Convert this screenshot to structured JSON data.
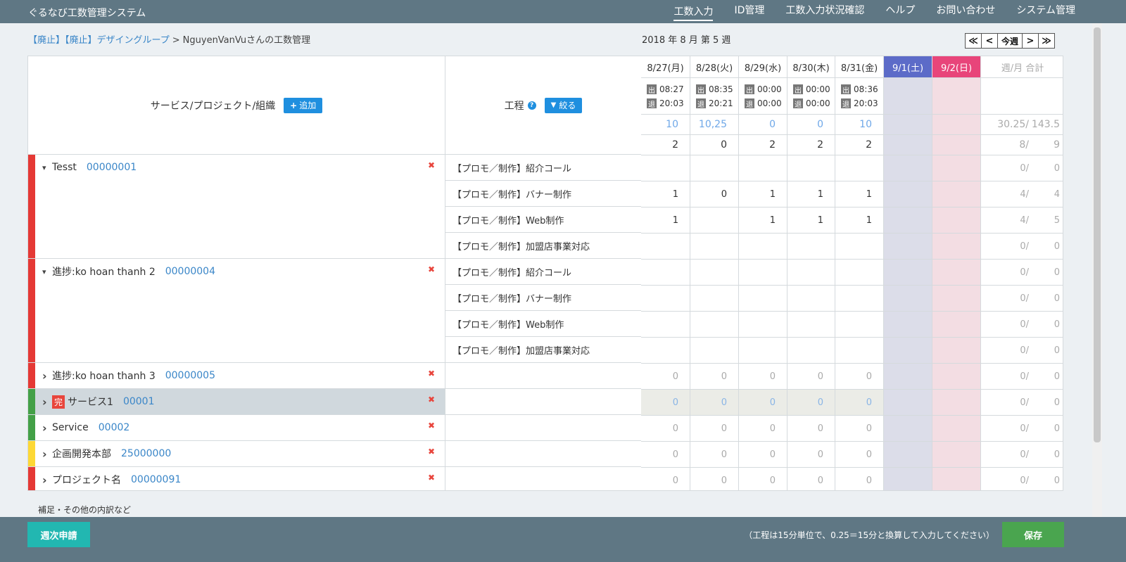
{
  "app": {
    "title": "ぐるなび工数管理システム"
  },
  "nav": [
    {
      "label": "工数入力",
      "active": true
    },
    {
      "label": "ID管理"
    },
    {
      "label": "工数入力状況確認"
    },
    {
      "label": "ヘルプ"
    },
    {
      "label": "お問い合わせ"
    },
    {
      "label": "システム管理"
    }
  ],
  "breadcrumb": {
    "part1": "【廃止】",
    "part2": "【廃止】デザイングループ",
    "sep": ">",
    "current": "NguyenVanVuさんの工数管理"
  },
  "week": {
    "label": "2018 年 8 月 第 5 週",
    "today_label": "今週",
    "first": "≪",
    "prev": "<",
    "next": ">",
    "last": "≫"
  },
  "header": {
    "services_label": "サービス/プロジェクト/組織",
    "add_label": "追加",
    "process_label": "工程",
    "filter_label": "絞る"
  },
  "days": [
    {
      "label": "8/27(月)",
      "in": "08:27",
      "out": "20:03",
      "sum": "10",
      "count": "2"
    },
    {
      "label": "8/28(火)",
      "in": "08:35",
      "out": "20:21",
      "sum": "10,25",
      "count": "0"
    },
    {
      "label": "8/29(水)",
      "in": "00:00",
      "out": "00:00",
      "sum": "0",
      "count": "2"
    },
    {
      "label": "8/30(木)",
      "in": "00:00",
      "out": "00:00",
      "sum": "0",
      "count": "2"
    },
    {
      "label": "8/31(金)",
      "in": "08:36",
      "out": "20:03",
      "sum": "10",
      "count": "2"
    },
    {
      "label": "9/1(土)"
    },
    {
      "label": "9/2(日)"
    }
  ],
  "time_tags": {
    "in": "出",
    "out": "退"
  },
  "total": {
    "label": "週/月 合計",
    "sum_a": "30.25/",
    "sum_b": "143.5",
    "count_a": "8/",
    "count_b": "9"
  },
  "groups": [
    {
      "name": "Tesst",
      "code": "00000001",
      "color": "#e53935",
      "expanded": true,
      "processes": [
        {
          "name": "【プロモ／制作】紹介コール",
          "values": [
            "",
            "",
            "",
            "",
            ""
          ],
          "tot_a": "0/",
          "tot_b": "0"
        },
        {
          "name": "【プロモ／制作】バナー制作",
          "values": [
            "1",
            "0",
            "1",
            "1",
            "1"
          ],
          "tot_a": "4/",
          "tot_b": "4"
        },
        {
          "name": "【プロモ／制作】Web制作",
          "values": [
            "1",
            "",
            "1",
            "1",
            "1"
          ],
          "tot_a": "4/",
          "tot_b": "5"
        },
        {
          "name": "【プロモ／制作】加盟店事業対応",
          "values": [
            "",
            "",
            "",
            "",
            ""
          ],
          "tot_a": "0/",
          "tot_b": "0"
        }
      ]
    },
    {
      "name": "進捗:ko hoan thanh 2",
      "code": "00000004",
      "color": "#e53935",
      "expanded": true,
      "processes": [
        {
          "name": "【プロモ／制作】紹介コール",
          "values": [
            "",
            "",
            "",
            "",
            ""
          ],
          "tot_a": "0/",
          "tot_b": "0"
        },
        {
          "name": "【プロモ／制作】バナー制作",
          "values": [
            "",
            "",
            "",
            "",
            ""
          ],
          "tot_a": "0/",
          "tot_b": "0"
        },
        {
          "name": "【プロモ／制作】Web制作",
          "values": [
            "",
            "",
            "",
            "",
            ""
          ],
          "tot_a": "0/",
          "tot_b": "0"
        },
        {
          "name": "【プロモ／制作】加盟店事業対応",
          "values": [
            "",
            "",
            "",
            "",
            ""
          ],
          "tot_a": "0/",
          "tot_b": "0"
        }
      ]
    },
    {
      "name": "進捗:ko hoan thanh 3",
      "code": "00000005",
      "color": "#e53935",
      "values": [
        "0",
        "0",
        "0",
        "0",
        "0"
      ],
      "tot_a": "0/",
      "tot_b": "0"
    },
    {
      "name": "サービス1",
      "code": "00001",
      "color": "#43a047",
      "done_tag": "完",
      "selected": true,
      "values": [
        "0",
        "0",
        "0",
        "0",
        "0"
      ],
      "tot_a": "0/",
      "tot_b": "0"
    },
    {
      "name": "Service",
      "code": "00002",
      "color": "#43a047",
      "values": [
        "0",
        "0",
        "0",
        "0",
        "0"
      ],
      "tot_a": "0/",
      "tot_b": "0"
    },
    {
      "name": "企画開発本部",
      "code": "25000000",
      "color": "#fdd835",
      "values": [
        "0",
        "0",
        "0",
        "0",
        "0"
      ],
      "tot_a": "0/",
      "tot_b": "0"
    },
    {
      "name": "プロジェクト名",
      "code": "00000091",
      "color": "#e53935",
      "values": [
        "0",
        "0",
        "0",
        "0",
        "0"
      ],
      "tot_a": "0/",
      "tot_b": "0"
    }
  ],
  "note": "補足・その他の内訳など",
  "footer": {
    "weekly_submit": "週次申請",
    "hint": "（工程は15分単位で、0.25＝15分と換算して入力してください）",
    "save": "保存"
  }
}
